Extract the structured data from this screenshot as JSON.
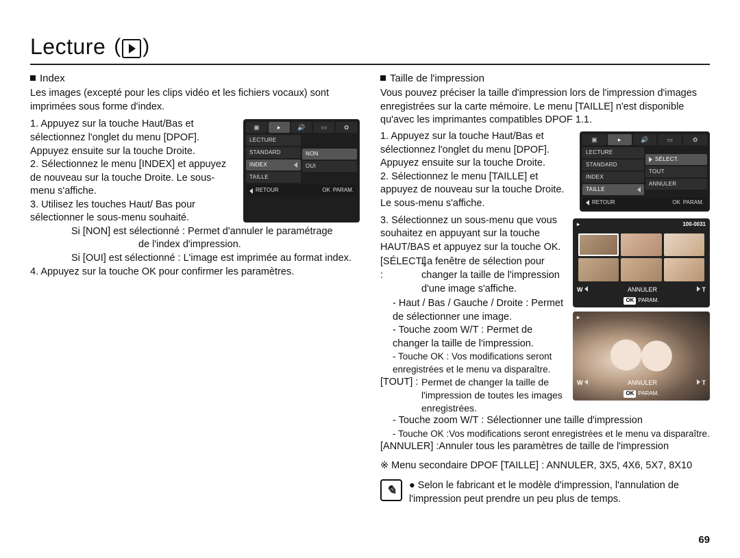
{
  "title": "Lecture",
  "left": {
    "heading": "Index",
    "intro": "Les images (excepté pour les clips vidéo et les fichiers vocaux) sont imprimées sous forme d'index.",
    "step1": "1. Appuyez sur la touche Haut/Bas et sélectionnez l'onglet du menu [DPOF]. Appuyez ensuite sur la touche Droite.",
    "step2": "2. Sélectionnez le menu [INDEX] et appuyez de nouveau sur la touche Droite. Le sous-menu s'affiche.",
    "step3": "3. Utilisez les touches Haut/ Bas pour sélectionner le sous-menu souhaité.",
    "sel_non": "Si [NON] est sélectionné : Permet d'annuler le paramétrage",
    "sel_non2": "de l'index d'impression.",
    "sel_oui": "Si [OUI] est sélectionné  : L'image est imprimée au format index.",
    "step4": "4. Appuyez sur la touche OK pour confirmer les paramètres."
  },
  "right": {
    "heading": "Taille de l'impression",
    "intro": "Vous pouvez préciser la taille d'impression lors de l'impression d'images enregistrées sur la carte mémoire. Le menu [TAILLE] n'est disponible qu'avec les imprimantes compatibles DPOF 1.1.",
    "step1": "1. Appuyez sur la touche Haut/Bas et sélectionnez l'onglet du menu [DPOF]. Appuyez ensuite sur la touche Droite.",
    "step2": "2. Sélectionnez le menu [TAILLE] et appuyez de nouveau sur la touche Droite. Le sous-menu s'affiche.",
    "step3": "3. Sélectionnez un sous-menu que vous souhaitez en appuyant sur la touche HAUT/BAS et appuyez sur la touche OK.",
    "r_select_lbl": "[SÉLECT.] :",
    "r_select": "La fenêtre de sélection pour changer la taille de l'impression d'une image s'affiche.",
    "r_hbd": "- Haut / Bas / Gauche / Droite : Permet de sélectionner une image.",
    "r_zoom": "- Touche zoom W/T : Permet de changer la taille de l'impression.",
    "r_ok": "- Touche OK : Vos modifications seront enregistrées et le menu va disparaître.",
    "r_tout_lbl": "[TOUT] :",
    "r_tout": "Permet de changer la taille de l'impression de toutes les images enregistrées.",
    "r_tout_zoom": "- Touche zoom W/T : Sélectionner une taille d'impression",
    "r_tout_ok": "- Touche OK :Vos modifications seront enregistrées et le menu va disparaître.",
    "r_ann_lbl": "[ANNULER] :",
    "r_ann": "Annuler tous les paramètres de taille de l'impression",
    "sizes": "※ Menu secondaire DPOF [TAILLE] : ANNULER, 3X5, 4X6, 5X7, 8X10",
    "note": "Selon le fabricant et le modèle d'impression, l'annulation de l'impression peut prendre un peu plus de temps."
  },
  "lcd_a": {
    "row1": "LECTURE",
    "left1": "STANDARD",
    "left2": "INDEX",
    "left3": "TAILLE",
    "right2": "NON",
    "right3": "OUI",
    "bar_retour": "RETOUR",
    "bar_ok": "OK",
    "bar_param": "PARAM."
  },
  "lcd_b": {
    "row1": "LECTURE",
    "left1": "STANDARD",
    "left2": "INDEX",
    "left3": "TAILLE",
    "right1": "SÉLECT.",
    "right2": "TOUT",
    "right3": "ANNULER",
    "bar_retour": "RETOUR",
    "bar_ok": "OK",
    "bar_param": "PARAM."
  },
  "lcd_c": {
    "counter": "100-0031",
    "w": "W",
    "t": "T",
    "mid": "ANNULER",
    "ok": "OK",
    "param": "PARAM."
  },
  "lcd_d": {
    "w": "W",
    "t": "T",
    "mid": "ANNULER",
    "ok": "OK",
    "param": "PARAM."
  },
  "page_number": "69"
}
